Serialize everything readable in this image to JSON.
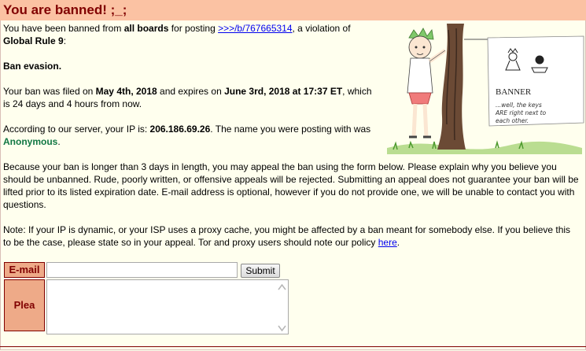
{
  "header": {
    "title": "You are banned! ;_;"
  },
  "intro": {
    "p1_a": "You have been banned from ",
    "p1_b": "all boards",
    "p1_c": " for posting ",
    "p1_link": ">>>/b/767665314",
    "p1_d": ", a violation of",
    "p1_e": "Global Rule 9",
    "p1_f": ":"
  },
  "reason": "Ban evasion.",
  "ban": {
    "a": "Your ban was filed on ",
    "filed": "May 4th, 2018",
    "b": " and expires on ",
    "expires": "June 3rd, 2018 at 17:37 ET",
    "c": ", which",
    "d": "is 24 days and 4 hours from now."
  },
  "ip": {
    "a": "According to our server, your IP is: ",
    "addr": "206.186.69.26",
    "b": ". The name you were posting with was",
    "name": "Anonymous",
    "c": "."
  },
  "appeal_text": [
    "Because your ban is longer than 3 days in length, you may appeal the ban using the form below. Please explain why you believe you",
    "should be unbanned. Rude, poorly written, or offensive appeals will be rejected. Submitting an appeal does not guarantee your ban will be",
    "lifted prior to its listed expiration date. E-mail address is optional, however if you do not provide one, we will be unable to contact you with",
    "questions."
  ],
  "note": {
    "line1": "Note: If your IP is dynamic, or your ISP uses a proxy cache, you might be affected by a ban meant for somebody else. If you believe this",
    "line2": "to be the case, please state so in your appeal. Tor and proxy users should note our policy ",
    "link": "here",
    "end": "."
  },
  "illustration": {
    "banner_word": "BANNER",
    "caption1": "...well, the keys",
    "caption2": "ARE right next to",
    "caption3": "each other."
  },
  "form": {
    "email_label": "E-mail",
    "email_value": "",
    "submit_label": "Submit",
    "plea_label": "Plea",
    "plea_value": ""
  }
}
